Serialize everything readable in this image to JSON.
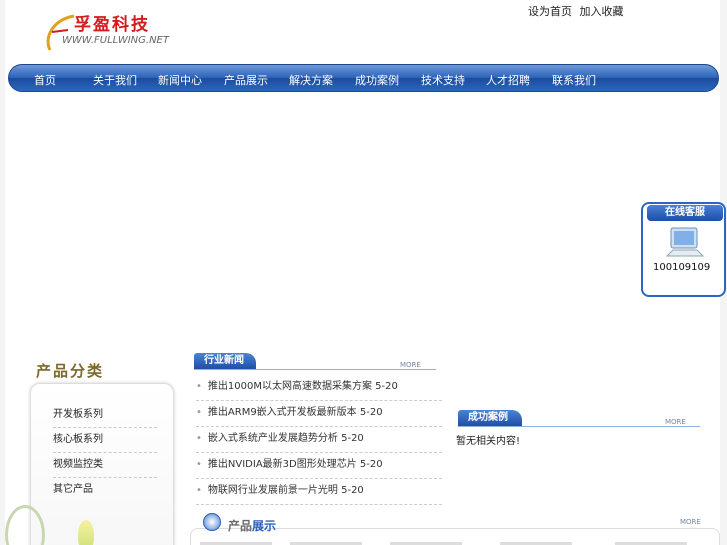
{
  "header": {
    "logo_name": "孚盈科技",
    "logo_url": "WWW.FULLWING.NET",
    "top_links": [
      "设为首页",
      "加入收藏"
    ]
  },
  "nav": {
    "items": [
      "首页",
      "关于我们",
      "新闻中心",
      "产品展示",
      "解决方案",
      "成功案例",
      "技术支持",
      "人才招聘",
      "联系我们"
    ]
  },
  "service": {
    "title": "在线客服",
    "number": "100109109"
  },
  "categories": {
    "title": "产品分类",
    "items": [
      "开发板系列",
      "核心板系列",
      "视频监控类",
      "其它产品"
    ]
  },
  "news": {
    "title": "行业新闻",
    "more": "MORE",
    "items": [
      {
        "text": "推出1000M以太网高速数据采集方案",
        "date": "5-20"
      },
      {
        "text": "推出ARM9嵌入式开发板最新版本",
        "date": "5-20"
      },
      {
        "text": "嵌入式系统产业发展趋势分析",
        "date": "5-20"
      },
      {
        "text": "推出NVIDIA最新3D图形处理芯片",
        "date": "5-20"
      },
      {
        "text": "物联网行业发展前景一片光明",
        "date": "5-20"
      }
    ]
  },
  "cases": {
    "title": "成功案例",
    "more": "MORE",
    "text": "暂无相关内容!"
  },
  "products": {
    "title_a": "产品",
    "title_b": "展示",
    "more": "MORE"
  },
  "colors": {
    "nav_blue": "#2a62b9",
    "logo_red": "#d21b1b"
  }
}
